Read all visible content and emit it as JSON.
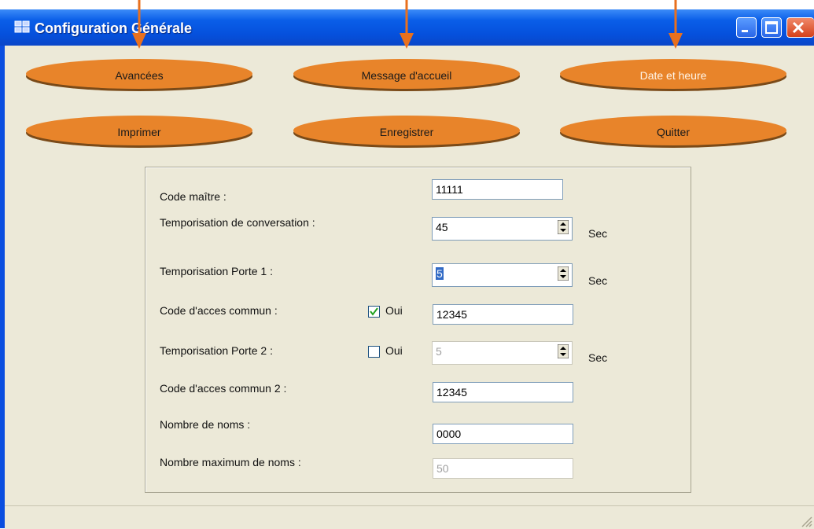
{
  "window": {
    "title": "Configuration Générale"
  },
  "buttons": {
    "avancees": "Avancées",
    "message": "Message d'accueil",
    "date": "Date et heure",
    "imprimer": "Imprimer",
    "enregistrer": "Enregistrer",
    "quitter": "Quitter"
  },
  "form": {
    "code_maitre": {
      "label": "Code maître :",
      "value": "11111"
    },
    "tempo_conv": {
      "label": "Temporisation de conversation :",
      "value": "45",
      "unit": "Sec"
    },
    "tempo_porte1": {
      "label": "Temporisation Porte 1 :",
      "value": "5",
      "unit": "Sec"
    },
    "code_commun": {
      "label": "Code d'acces commun :",
      "checkbox": "Oui",
      "checked": true,
      "value": "12345"
    },
    "tempo_porte2": {
      "label": "Temporisation Porte 2 :",
      "checkbox": "Oui",
      "checked": false,
      "value": "5",
      "unit": "Sec"
    },
    "code_commun2": {
      "label": "Code d'acces commun 2 :",
      "value": "12345"
    },
    "nb_noms": {
      "label": "Nombre de noms :",
      "value": "0000"
    },
    "nb_max_noms": {
      "label": "Nombre maximum de  noms :",
      "value": "50"
    }
  },
  "colors": {
    "accent": "#e8842a",
    "titlebar": "#0a5ee8",
    "arrow": "#e8701e"
  }
}
